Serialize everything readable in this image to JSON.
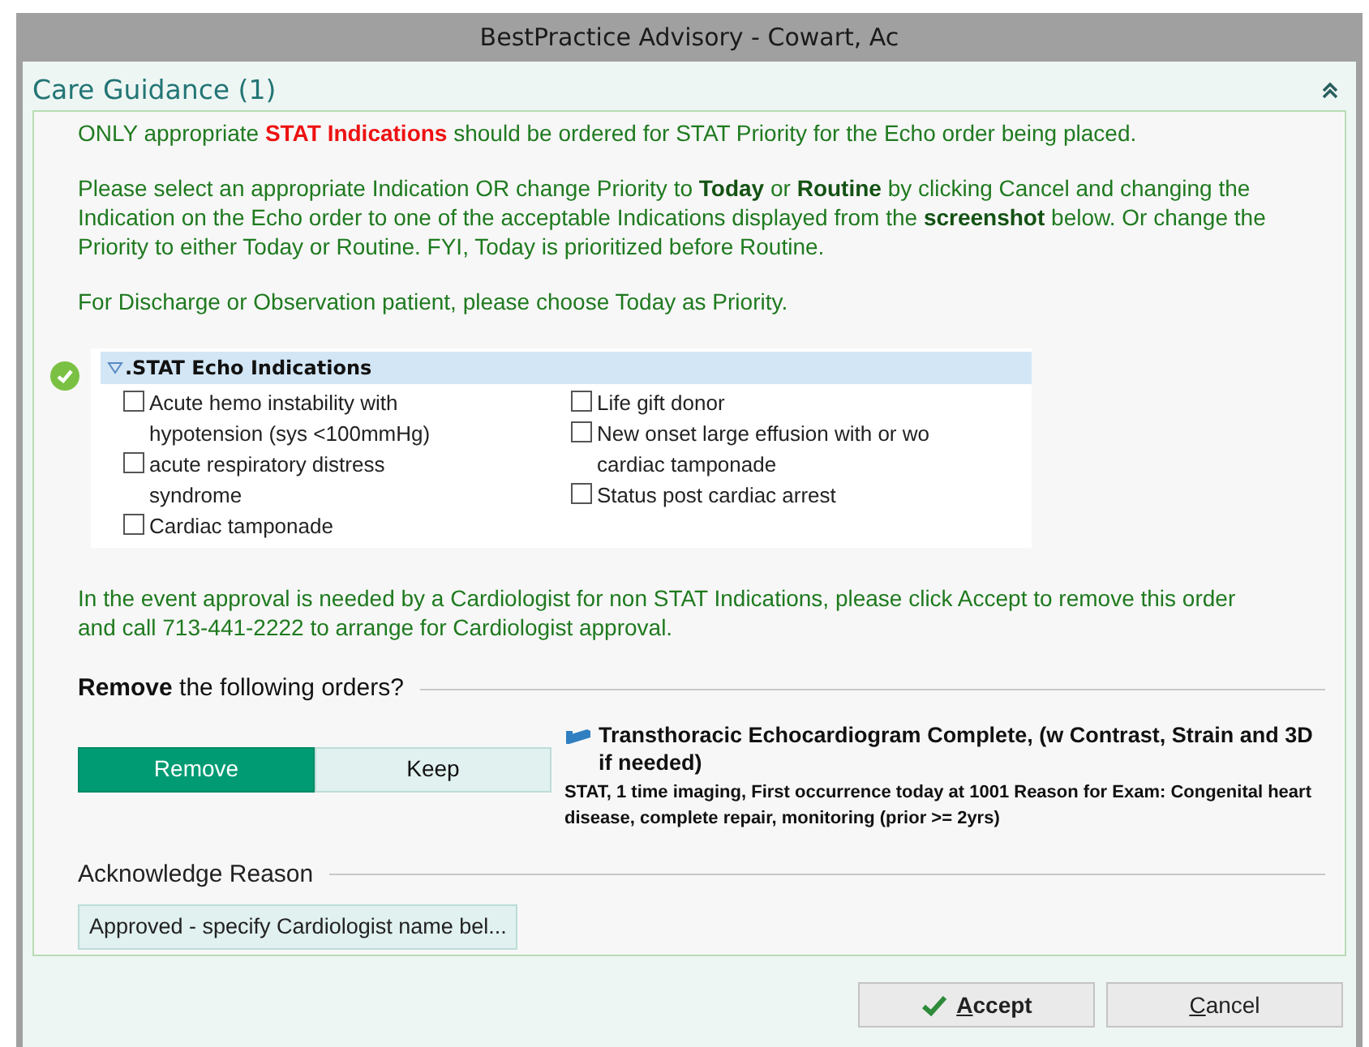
{
  "window": {
    "title": "BestPractice Advisory - Cowart, Ac"
  },
  "section": {
    "title": "Care Guidance (1)",
    "expanded": true
  },
  "paragraphs": [
    {
      "segments": [
        {
          "text": "ONLY appropriate ",
          "kind": "plain"
        },
        {
          "text": "STAT Indications",
          "kind": "alert"
        },
        {
          "text": " should be ordered for STAT Priority for the Echo order being placed.",
          "kind": "plain"
        }
      ]
    },
    {
      "segments": [
        {
          "text": "Please select an appropriate Indication OR change Priority to ",
          "kind": "plain"
        },
        {
          "text": "Today",
          "kind": "emphasis"
        },
        {
          "text": " or ",
          "kind": "plain"
        },
        {
          "text": "Routine",
          "kind": "emphasis"
        },
        {
          "text": " by clicking Cancel and changing the Indication on the Echo order to one of the acceptable Indications displayed from the ",
          "kind": "plain"
        },
        {
          "text": "screenshot",
          "kind": "emphasis"
        },
        {
          "text": " below.  Or change the Priority to either Today or Routine. FYI, Today is prioritized before Routine.",
          "kind": "plain"
        }
      ]
    },
    {
      "segments": [
        {
          "text": "For Discharge or Observation patient, please choose Today as Priority.",
          "kind": "plain"
        }
      ]
    }
  ],
  "indications": {
    "title": ".STAT Echo Indications",
    "expanded": true,
    "columns": [
      [
        {
          "label": "Acute hemo instability with hypotension (sys <100mmHg)",
          "checked": false
        },
        {
          "label": "acute respiratory distress syndrome",
          "checked": false
        },
        {
          "label": "Cardiac tamponade",
          "checked": false
        }
      ],
      [
        {
          "label": "Life gift donor",
          "checked": false
        },
        {
          "label": "New onset large effusion with or wo cardiac tamponade",
          "checked": false
        },
        {
          "label": "Status post cardiac arrest",
          "checked": false
        }
      ]
    ]
  },
  "note": "In the event approval is needed by a Cardiologist for non STAT Indications, please click Accept to remove this order and call 713-441-2222 to arrange for Cardiologist approval.",
  "remove_heading": "**Remove** the following orders?",
  "choices": [
    {
      "label": "Remove",
      "selected": true
    },
    {
      "label": "Keep",
      "selected": false
    }
  ],
  "order": {
    "title": "Transthoracic Echocardiogram Complete, (w Contrast, Strain and 3D if needed)",
    "details": "STAT, 1 time imaging, First occurrence today at 1001 Reason for Exam: Congenital heart disease, complete repair, monitoring (prior >= 2yrs)"
  },
  "acknowledge": {
    "heading": "Acknowledge Reason",
    "options": [
      {
        "label": "Approved - specify Cardiologist name bel...",
        "selected": false
      }
    ]
  },
  "buttons": [
    {
      "kind": "accept",
      "mnemonic": "A",
      "rest": "ccept"
    },
    {
      "kind": "cancel",
      "mnemonic": "C",
      "rest": "ancel"
    }
  ]
}
